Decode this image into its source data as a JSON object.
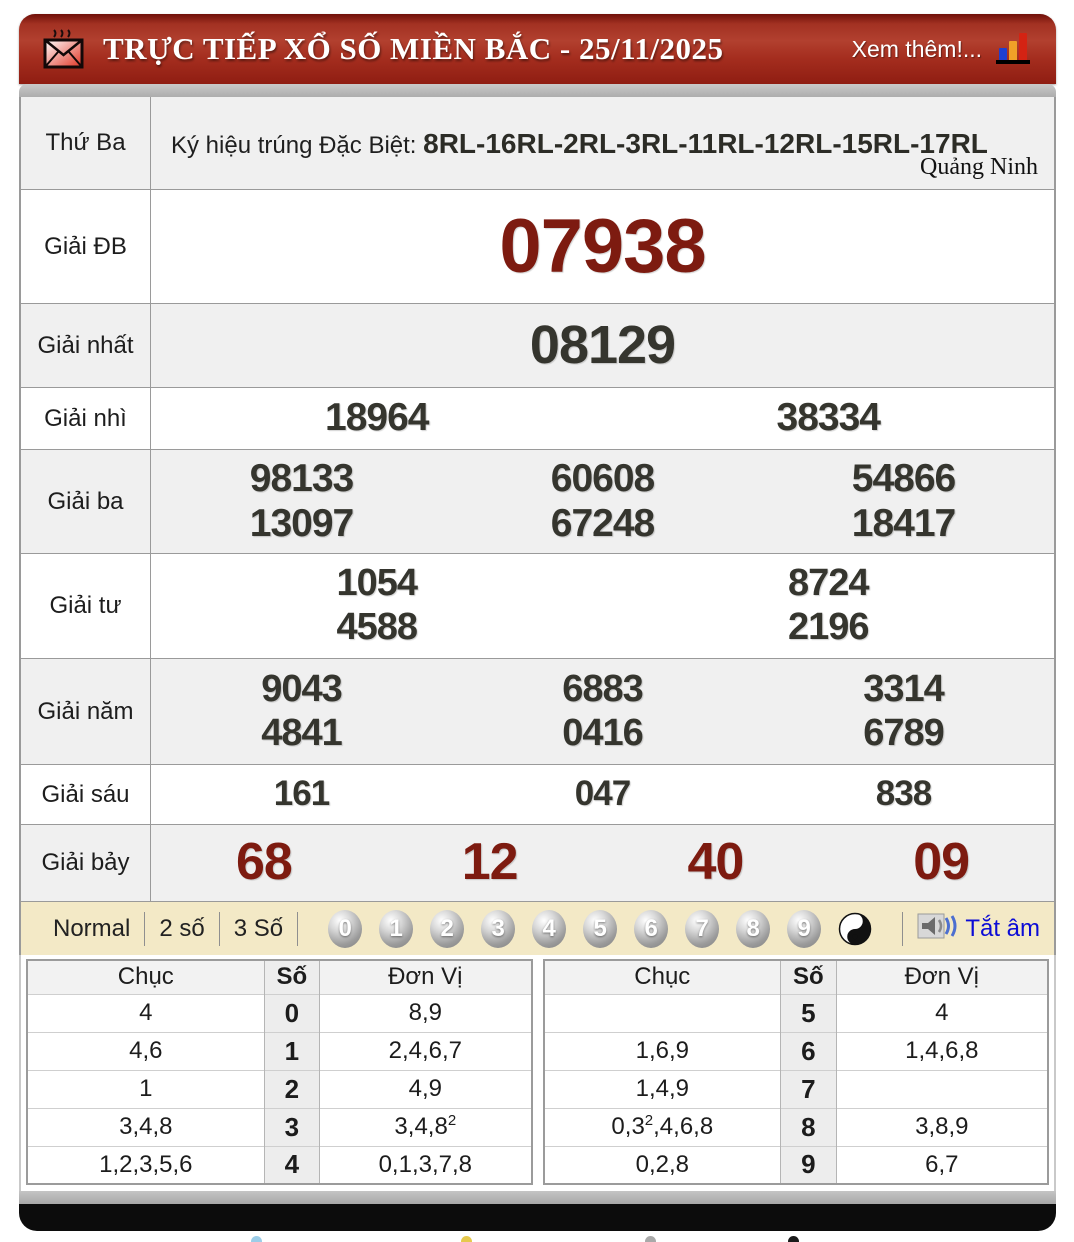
{
  "header": {
    "title": "TRỰC TIẾP XỔ SỐ MIỀN BẮC - 25/11/2025",
    "more_label": "Xem thêm!...",
    "icons": [
      "mail-icon",
      "bar-chart-icon"
    ]
  },
  "info": {
    "day": "Thứ Ba",
    "sign_label": "Ký hiệu trúng Đặc Biệt: ",
    "sign_value": "8RL-16RL-2RL-3RL-11RL-12RL-15RL-17RL",
    "province": "Quảng Ninh"
  },
  "prizes": [
    {
      "label": "Giải ĐB",
      "lines": [
        [
          "07938"
        ]
      ]
    },
    {
      "label": "Giải nhất",
      "lines": [
        [
          "08129"
        ]
      ]
    },
    {
      "label": "Giải nhì",
      "lines": [
        [
          "18964",
          "38334"
        ]
      ]
    },
    {
      "label": "Giải ba",
      "lines": [
        [
          "98133",
          "60608",
          "54866"
        ],
        [
          "13097",
          "67248",
          "18417"
        ]
      ]
    },
    {
      "label": "Giải tư",
      "lines": [
        [
          "1054",
          "8724"
        ],
        [
          "4588",
          "2196"
        ]
      ]
    },
    {
      "label": "Giải năm",
      "lines": [
        [
          "9043",
          "6883",
          "3314"
        ],
        [
          "4841",
          "0416",
          "6789"
        ]
      ]
    },
    {
      "label": "Giải sáu",
      "lines": [
        [
          "161",
          "047",
          "838"
        ]
      ]
    },
    {
      "label": "Giải bảy",
      "lines": [
        [
          "68",
          "12",
          "40",
          "09"
        ]
      ]
    }
  ],
  "controls": {
    "modes": [
      "Normal",
      "2 số",
      "3 Số"
    ],
    "balls": [
      "0",
      "1",
      "2",
      "3",
      "4",
      "5",
      "6",
      "7",
      "8",
      "9"
    ],
    "icons": [
      "yin-yang-icon",
      "speaker-icon"
    ],
    "mute_label": "Tắt âm"
  },
  "loto": {
    "headers": [
      "Chục",
      "Số",
      "Đơn Vị"
    ],
    "left": [
      {
        "chuc": {
          "pre": "4"
        },
        "so": "0",
        "donvi": {
          "pre": "8,9"
        }
      },
      {
        "chuc": {
          "pre": "4,6"
        },
        "so": "1",
        "donvi": {
          "pre": "2,4,6,7"
        }
      },
      {
        "chuc": {
          "pre": "1"
        },
        "so": "2",
        "donvi": {
          "pre": "4,9"
        }
      },
      {
        "chuc": {
          "pre": "3,4,8"
        },
        "so": "3",
        "donvi": {
          "pre": "3,4,8",
          "sup": "2"
        }
      },
      {
        "chuc": {
          "pre": "1,2,3,5,6"
        },
        "so": "4",
        "donvi": {
          "pre": "0,1,3,7,8"
        }
      }
    ],
    "right": [
      {
        "chuc": {
          "pre": ""
        },
        "so": "5",
        "donvi": {
          "pre": "4"
        }
      },
      {
        "chuc": {
          "pre": "1,6,9"
        },
        "so": "6",
        "donvi": {
          "pre": "1,4,6,8"
        }
      },
      {
        "chuc": {
          "pre": "1,4,9"
        },
        "so": "7",
        "donvi": {
          "pre": ""
        }
      },
      {
        "chuc": {
          "pre": "0,3",
          "sup": "2",
          "post": ",4,6,8"
        },
        "so": "8",
        "donvi": {
          "pre": "3,8,9"
        }
      },
      {
        "chuc": {
          "pre": "0,2,8"
        },
        "so": "9",
        "donvi": {
          "pre": "6,7"
        }
      }
    ]
  },
  "colors": {
    "accent_red": "#a52e1f",
    "prize_red": "#7d1b10",
    "number_dark": "#35352e",
    "control_beige": "#f3e9c6",
    "link_blue": "#0b0bd6"
  }
}
